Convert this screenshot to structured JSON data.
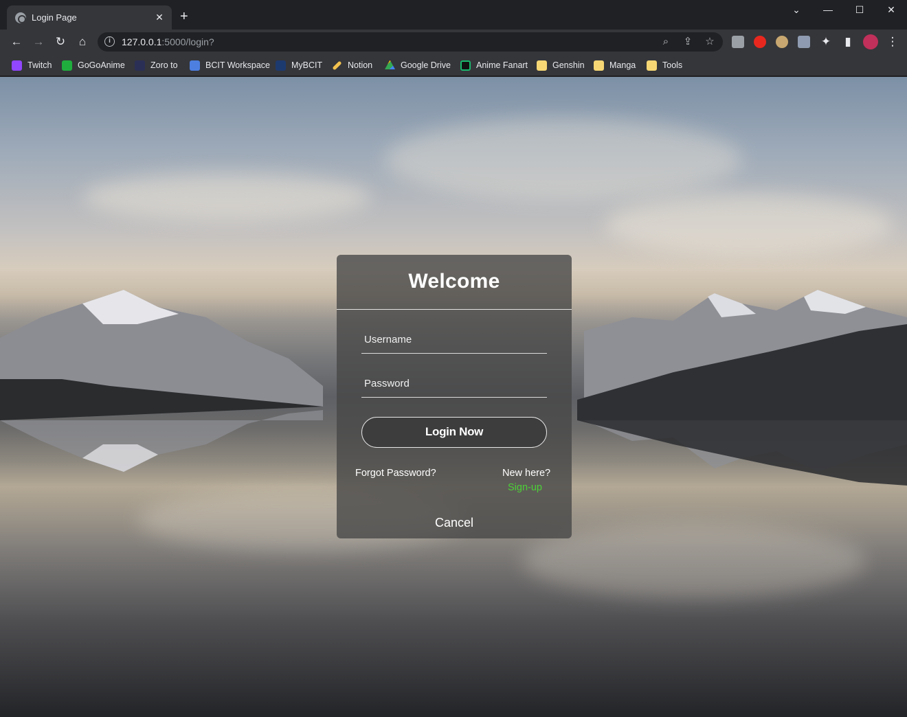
{
  "browser": {
    "tab": {
      "title": "Login Page",
      "close": "✕"
    },
    "new_tab": "+",
    "window_controls": {
      "tab_search": "⌄",
      "minimize": "—",
      "maximize": "☐",
      "close": "✕"
    },
    "nav": {
      "back": "←",
      "forward": "→",
      "reload": "↻",
      "home": "⌂"
    },
    "address": {
      "host": "127.0.0.1",
      "rest": ":5000/login?"
    },
    "omnibox_icons": {
      "zoom": "⌕",
      "share": "⇪",
      "bookmark": "☆"
    },
    "toolbar_icons": {
      "extensions": "✦",
      "side_panel": "▮",
      "menu": "⋮"
    }
  },
  "bookmarks": [
    {
      "label": "Twitch",
      "icon": "twitch-icon",
      "color": "#9146ff"
    },
    {
      "label": "GoGoAnime",
      "icon": "gogoanime-icon",
      "color": "#1fae3e"
    },
    {
      "label": "Zoro to",
      "icon": "zoro-icon",
      "color": "#6f7df0"
    },
    {
      "label": "BCIT Workspace",
      "icon": "lock-icon",
      "color": "#4d7fe0"
    },
    {
      "label": "MyBCIT",
      "icon": "bcit-icon",
      "color": "#1d3a6e"
    },
    {
      "label": "Notion",
      "icon": "pencil-icon",
      "color": "#f2c14e"
    },
    {
      "label": "Google Drive",
      "icon": "google-drive-icon",
      "color": "#34a853"
    },
    {
      "label": "Anime Fanart",
      "icon": "fanart-icon",
      "color": "#19b86d"
    },
    {
      "label": "Genshin",
      "icon": "folder-icon",
      "color": "#f7d774"
    },
    {
      "label": "Manga",
      "icon": "folder-icon",
      "color": "#f7d774"
    },
    {
      "label": "Tools",
      "icon": "folder-icon",
      "color": "#f7d774"
    }
  ],
  "login": {
    "title": "Welcome",
    "username_placeholder": "Username",
    "password_placeholder": "Password",
    "login_button": "Login Now",
    "forgot_password": "Forgot Password?",
    "new_here": "New here?",
    "signup": "Sign-up",
    "cancel": "Cancel",
    "signup_color": "#4cd137"
  }
}
